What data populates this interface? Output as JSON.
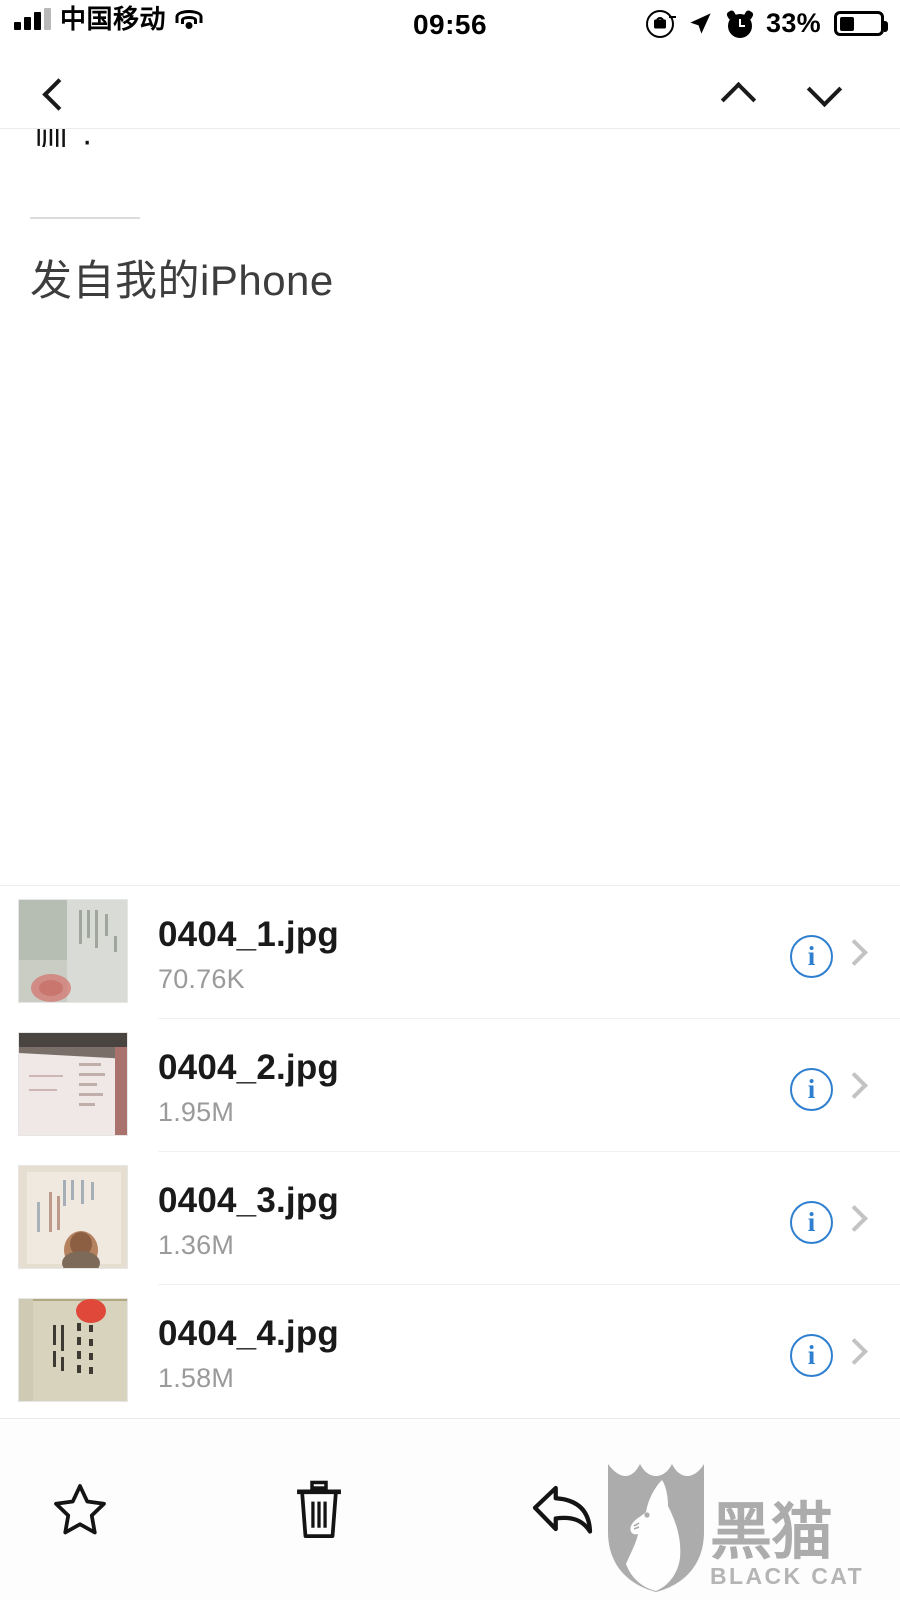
{
  "status_bar": {
    "carrier": "中国移动",
    "time": "09:56",
    "battery_percent": "33%",
    "signal_icon": "signal-bars-icon",
    "wifi_icon": "wifi-icon",
    "rotation_lock_icon": "rotation-lock-icon",
    "location_icon": "location-arrow-icon",
    "alarm_icon": "alarm-clock-icon",
    "battery_icon": "battery-icon",
    "battery_level": 33
  },
  "nav_bar": {
    "back_icon": "chevron-left-icon",
    "prev_message_icon": "chevron-up-icon",
    "next_message_icon": "chevron-down-icon"
  },
  "message": {
    "clipped_text": "则 ·",
    "signature": "发自我的iPhone"
  },
  "attachments": [
    {
      "name": "0404_1.jpg",
      "size": "70.76K",
      "info_icon": "info-circle-icon",
      "chevron_icon": "chevron-right-icon"
    },
    {
      "name": "0404_2.jpg",
      "size": "1.95M",
      "info_icon": "info-circle-icon",
      "chevron_icon": "chevron-right-icon"
    },
    {
      "name": "0404_3.jpg",
      "size": "1.36M",
      "info_icon": "info-circle-icon",
      "chevron_icon": "chevron-right-icon"
    },
    {
      "name": "0404_4.jpg",
      "size": "1.58M",
      "info_icon": "info-circle-icon",
      "chevron_icon": "chevron-right-icon"
    }
  ],
  "toolbar": {
    "flag_icon": "star-icon",
    "delete_icon": "trash-icon",
    "reply_icon": "reply-arrow-icon"
  },
  "watermark": {
    "chinese": "黑猫",
    "english": "BLACK CAT",
    "shield_icon": "cat-shield-logo-icon"
  },
  "colors": {
    "accent_blue": "#2f7fd0",
    "chevron_gray": "#c3c3c3",
    "text_primary": "#1a1a1a",
    "text_secondary": "#9a9a9a",
    "watermark_gray": "#8d8d8d",
    "background": "#ffffff"
  }
}
